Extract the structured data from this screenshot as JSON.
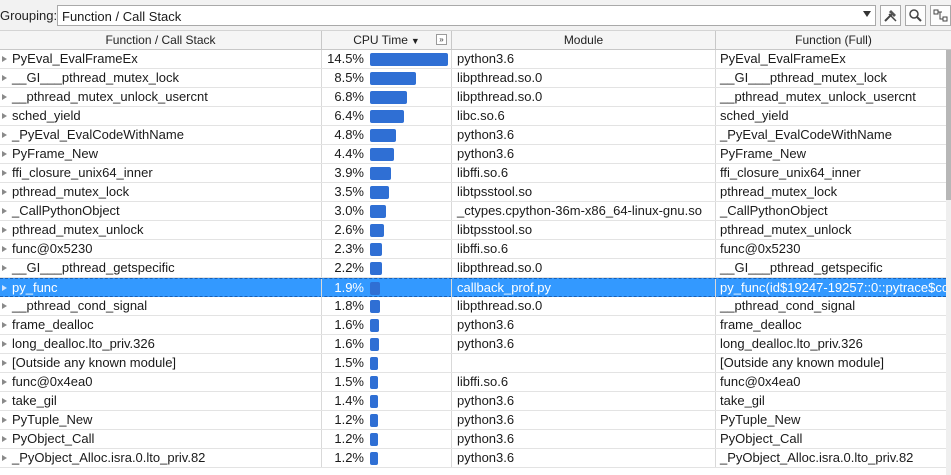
{
  "toolbar": {
    "grouping_label": "Grouping:",
    "grouping_value": "Function / Call Stack",
    "buttons": [
      "tools-icon",
      "search-icon",
      "view-options-icon"
    ]
  },
  "columns": {
    "function": "Function / Call Stack",
    "cpu_time": "CPU Time",
    "cpu_sort_indicator": "▼",
    "cpu_expand": "»",
    "module": "Module",
    "function_full": "Function (Full)"
  },
  "colors": {
    "bar": "#2f6fd4",
    "selection": "#3399ff"
  },
  "rows": [
    {
      "func": "PyEval_EvalFrameEx",
      "cpu": "14.5%",
      "cpu_value": 14.5,
      "module": "python3.6",
      "full": "PyEval_EvalFrameEx"
    },
    {
      "func": "__GI___pthread_mutex_lock",
      "cpu": "8.5%",
      "cpu_value": 8.5,
      "module": "libpthread.so.0",
      "full": "__GI___pthread_mutex_lock"
    },
    {
      "func": "__pthread_mutex_unlock_usercnt",
      "cpu": "6.8%",
      "cpu_value": 6.8,
      "module": "libpthread.so.0",
      "full": "__pthread_mutex_unlock_usercnt"
    },
    {
      "func": "sched_yield",
      "cpu": "6.4%",
      "cpu_value": 6.4,
      "module": "libc.so.6",
      "full": "sched_yield"
    },
    {
      "func": "_PyEval_EvalCodeWithName",
      "cpu": "4.8%",
      "cpu_value": 4.8,
      "module": "python3.6",
      "full": "_PyEval_EvalCodeWithName"
    },
    {
      "func": "PyFrame_New",
      "cpu": "4.4%",
      "cpu_value": 4.4,
      "module": "python3.6",
      "full": "PyFrame_New"
    },
    {
      "func": "ffi_closure_unix64_inner",
      "cpu": "3.9%",
      "cpu_value": 3.9,
      "module": "libffi.so.6",
      "full": "ffi_closure_unix64_inner"
    },
    {
      "func": "pthread_mutex_lock",
      "cpu": "3.5%",
      "cpu_value": 3.5,
      "module": "libtpsstool.so",
      "full": "pthread_mutex_lock"
    },
    {
      "func": "_CallPythonObject",
      "cpu": "3.0%",
      "cpu_value": 3.0,
      "module": "_ctypes.cpython-36m-x86_64-linux-gnu.so",
      "full": "_CallPythonObject"
    },
    {
      "func": "pthread_mutex_unlock",
      "cpu": "2.6%",
      "cpu_value": 2.6,
      "module": "libtpsstool.so",
      "full": "pthread_mutex_unlock"
    },
    {
      "func": "func@0x5230",
      "cpu": "2.3%",
      "cpu_value": 2.3,
      "module": "libffi.so.6",
      "full": "func@0x5230"
    },
    {
      "func": "__GI___pthread_getspecific",
      "cpu": "2.2%",
      "cpu_value": 2.2,
      "module": "libpthread.so.0",
      "full": "__GI___pthread_getspecific"
    },
    {
      "func": "py_func",
      "cpu": "1.9%",
      "cpu_value": 1.9,
      "module": "callback_prof.py",
      "full": "py_func(id$19247-19257::0::pytrace$co",
      "selected": true
    },
    {
      "func": "__pthread_cond_signal",
      "cpu": "1.8%",
      "cpu_value": 1.8,
      "module": "libpthread.so.0",
      "full": "__pthread_cond_signal"
    },
    {
      "func": "frame_dealloc",
      "cpu": "1.6%",
      "cpu_value": 1.6,
      "module": "python3.6",
      "full": "frame_dealloc"
    },
    {
      "func": "long_dealloc.lto_priv.326",
      "cpu": "1.6%",
      "cpu_value": 1.6,
      "module": "python3.6",
      "full": "long_dealloc.lto_priv.326"
    },
    {
      "func": "[Outside any known module]",
      "cpu": "1.5%",
      "cpu_value": 1.5,
      "module": "",
      "full": "[Outside any known module]"
    },
    {
      "func": "func@0x4ea0",
      "cpu": "1.5%",
      "cpu_value": 1.5,
      "module": "libffi.so.6",
      "full": "func@0x4ea0"
    },
    {
      "func": "take_gil",
      "cpu": "1.4%",
      "cpu_value": 1.4,
      "module": "python3.6",
      "full": "take_gil"
    },
    {
      "func": "PyTuple_New",
      "cpu": "1.2%",
      "cpu_value": 1.2,
      "module": "python3.6",
      "full": "PyTuple_New"
    },
    {
      "func": "PyObject_Call",
      "cpu": "1.2%",
      "cpu_value": 1.2,
      "module": "python3.6",
      "full": "PyObject_Call"
    },
    {
      "func": "_PyObject_Alloc.isra.0.lto_priv.82",
      "cpu": "1.2%",
      "cpu_value": 1.2,
      "module": "python3.6",
      "full": "_PyObject_Alloc.isra.0.lto_priv.82"
    }
  ]
}
